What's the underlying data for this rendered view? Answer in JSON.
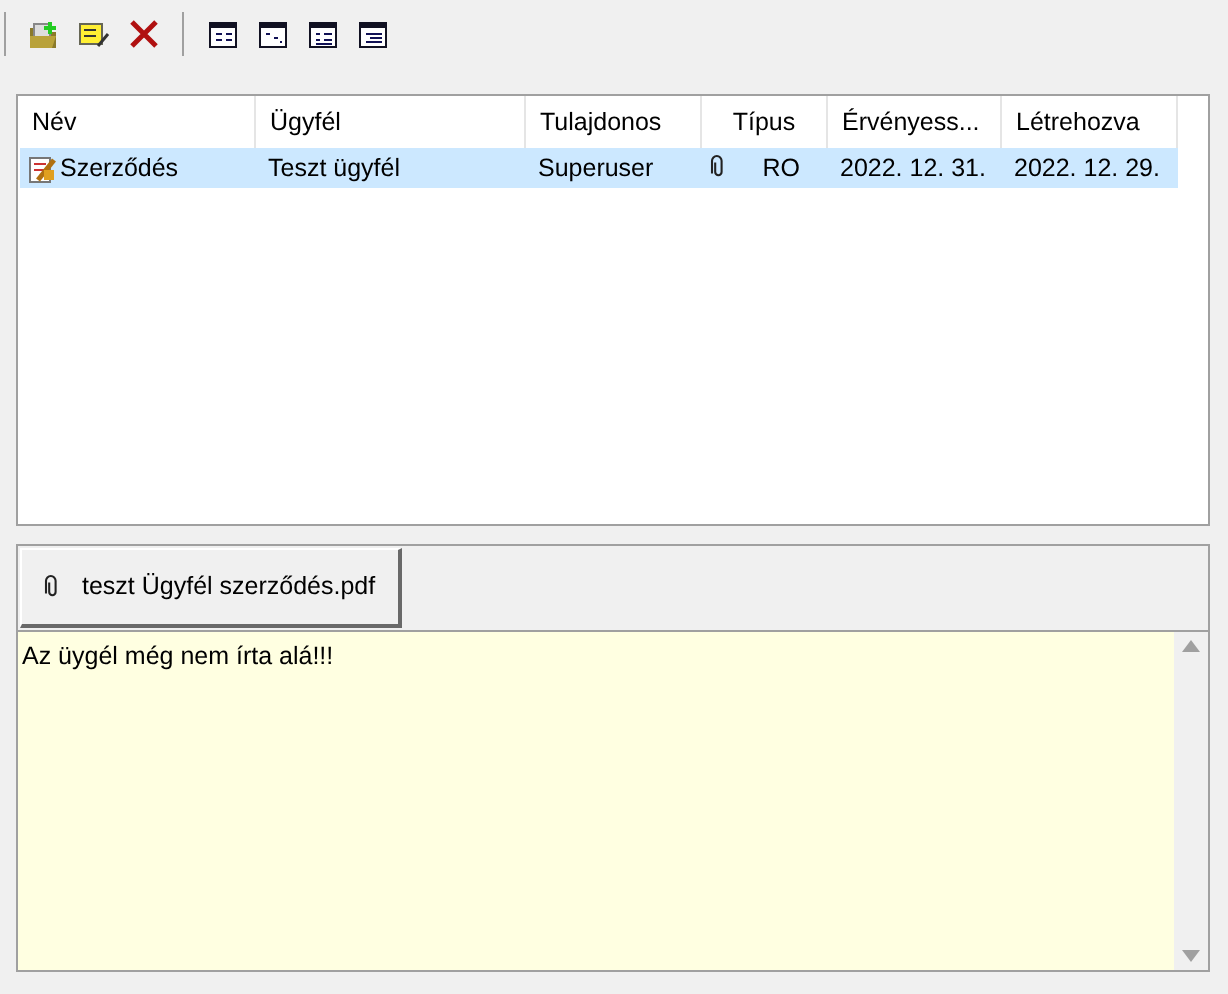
{
  "toolbar": [
    {
      "kind": "new"
    },
    {
      "kind": "edit"
    },
    {
      "kind": "delete"
    },
    {
      "kind": "sep"
    },
    {
      "kind": "view1"
    },
    {
      "kind": "view2"
    },
    {
      "kind": "view3"
    },
    {
      "kind": "view4"
    }
  ],
  "table": {
    "columns": [
      "Név",
      "Ügyfél",
      "Tulajdonos",
      "Típus",
      "Érvényess...",
      "Létrehozva"
    ],
    "rows": [
      {
        "selected": true,
        "attachment": true,
        "cells": [
          "Szerződés",
          "Teszt ügyfél",
          "Superuser",
          "RO",
          "2022. 12. 31.",
          "2022. 12. 29."
        ]
      }
    ]
  },
  "attachments": [
    {
      "name": "teszt Ügyfél szerződés.pdf"
    }
  ],
  "note": "Az üygél még nem írta alá!!!"
}
